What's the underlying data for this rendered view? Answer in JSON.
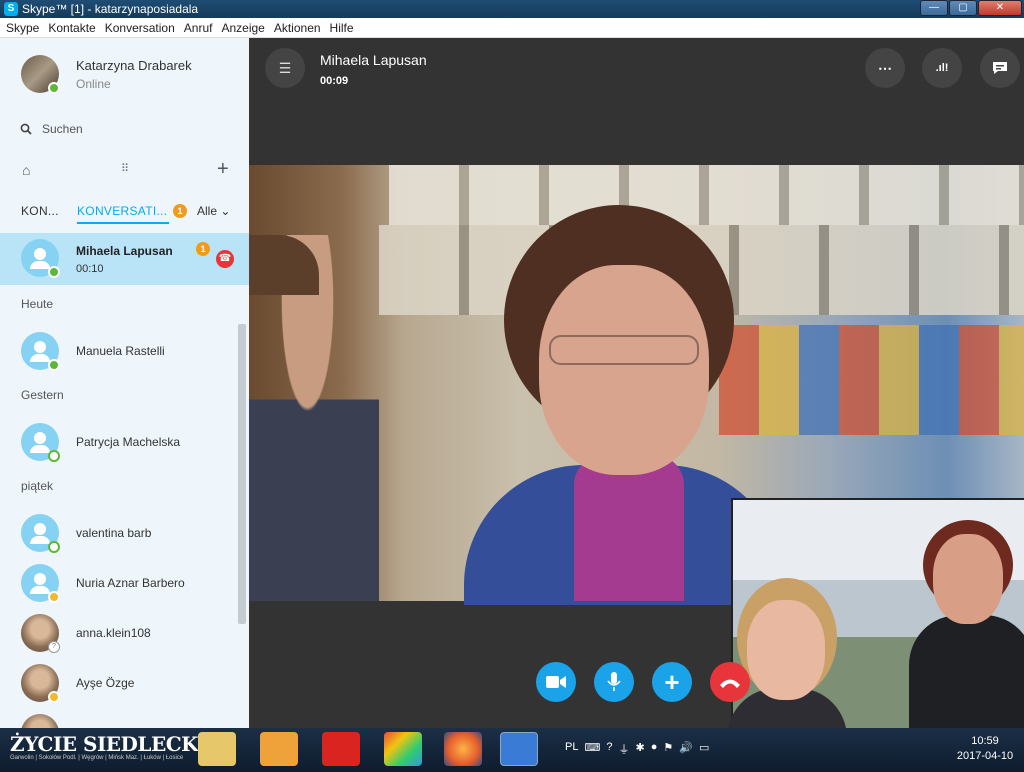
{
  "window": {
    "title": "Skype™ [1] - katarzynaposiadala",
    "app_icon": "S",
    "buttons": [
      "—",
      "▢",
      "✕"
    ]
  },
  "menu": [
    "Skype",
    "Kontakte",
    "Konversation",
    "Anruf",
    "Anzeige",
    "Aktionen",
    "Hilfe"
  ],
  "profile": {
    "name": "Katarzyna Drabarek",
    "status": "Online"
  },
  "search": {
    "placeholder": "Suchen"
  },
  "tabs": {
    "contacts": "KON...",
    "conversations": "KONVERSATI...",
    "badge": "1",
    "filter": "Alle ⌄"
  },
  "active_conversation": {
    "name": "Mihaela Lapusan",
    "duration": "00:10",
    "badge": "1"
  },
  "sections": {
    "today": "Heute",
    "yesterday": "Gestern",
    "friday": "piątek"
  },
  "conversations": [
    {
      "name": "Manuela Rastelli",
      "presence": "online"
    },
    {
      "name": "Patrycja Machelska",
      "presence": "offline"
    },
    {
      "name": "valentina barb",
      "presence": "offline"
    },
    {
      "name": "Nuria Aznar Barbero",
      "presence": "away"
    },
    {
      "name": "anna.klein108",
      "presence": "unknown"
    },
    {
      "name": "Ayşe Özge",
      "presence": "away"
    }
  ],
  "call": {
    "caller": "Mihaela Lapusan",
    "timer": "00:09",
    "top_buttons": [
      "⋯",
      ".ıl!",
      "💬"
    ],
    "controls": [
      "video",
      "mic",
      "add",
      "end"
    ]
  },
  "taskbar": {
    "watermark": "ŻYCIE SIEDLECKIE",
    "watermark_sub": "Garwolin | Sokołów Podl. | Węgrów | Mińsk Maz. | Łuków | Łosice",
    "language": "PL",
    "time": "10:59",
    "date": "2017-04-10"
  },
  "colors": {
    "accent": "#00aff0",
    "badge": "#f29b1b",
    "hangup": "#e8343b",
    "online": "#5cb836",
    "away": "#f3b82b"
  }
}
